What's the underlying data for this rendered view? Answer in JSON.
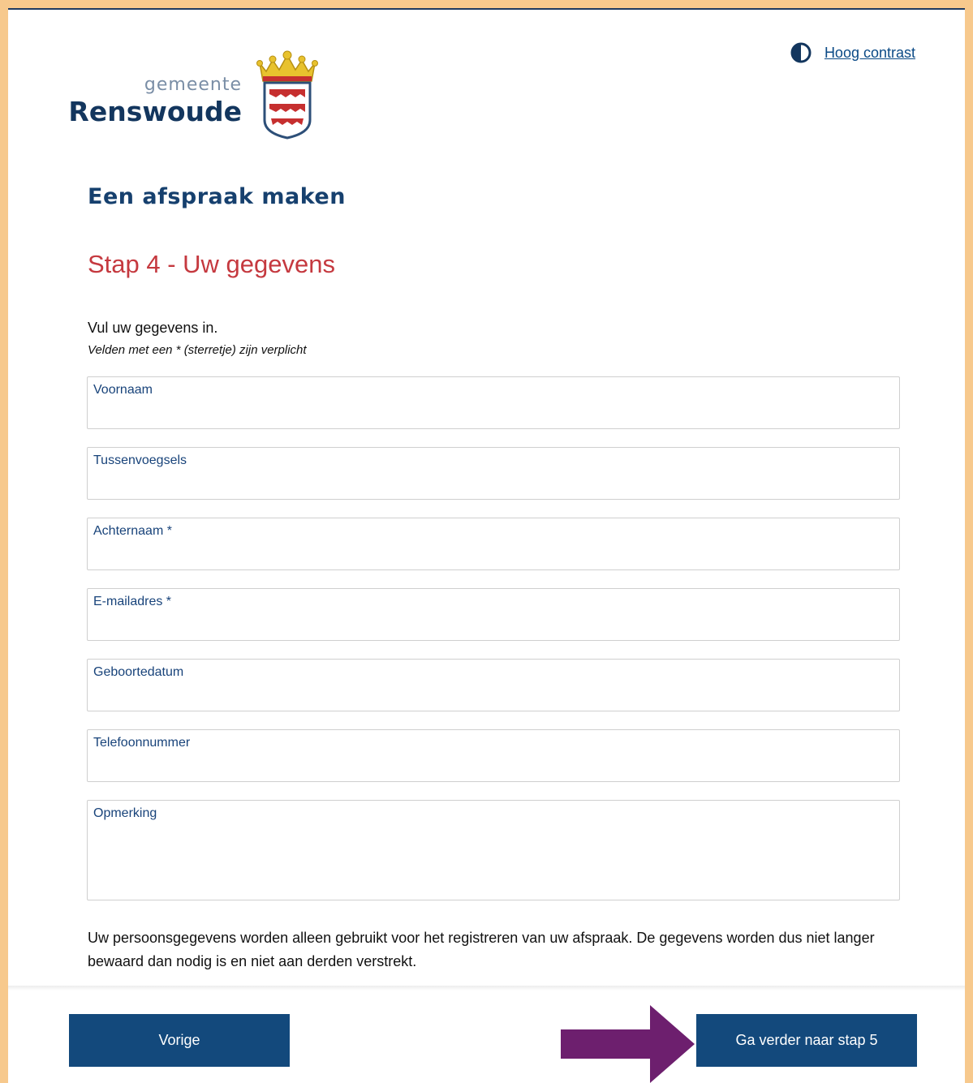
{
  "header": {
    "contrast_link": "Hoog contrast",
    "logo_small": "gemeente",
    "logo_big": "Renswoude"
  },
  "page_title": "Een afspraak maken",
  "step_title": "Stap 4 - Uw gegevens",
  "intro": "Vul uw gegevens in.",
  "required_note": "Velden met een * (sterretje) zijn verplicht",
  "fields": {
    "voornaam": {
      "label": "Voornaam",
      "value": ""
    },
    "tussenvoegsels": {
      "label": "Tussenvoegsels",
      "value": ""
    },
    "achternaam": {
      "label": "Achternaam *",
      "value": ""
    },
    "email": {
      "label": "E-mailadres *",
      "value": ""
    },
    "geboortedatum": {
      "label": "Geboortedatum",
      "value": ""
    },
    "telefoon": {
      "label": "Telefoonnummer",
      "value": ""
    },
    "opmerking": {
      "label": "Opmerking",
      "value": ""
    }
  },
  "privacy_text": "Uw persoonsgegevens worden alleen gebruikt voor het registreren van uw afspraak. De gegevens worden dus niet langer bewaard dan nodig is en niet aan derden verstrekt.",
  "buttons": {
    "prev": "Vorige",
    "next": "Ga verder naar stap 5"
  },
  "colors": {
    "frame": "#f7c98d",
    "heading": "#16406e",
    "step": "#c5393f",
    "button": "#13497c",
    "arrow": "#6d1f6e"
  },
  "icons": {
    "contrast": "half-circle-contrast-icon",
    "arrow": "right-arrow-annotation"
  }
}
